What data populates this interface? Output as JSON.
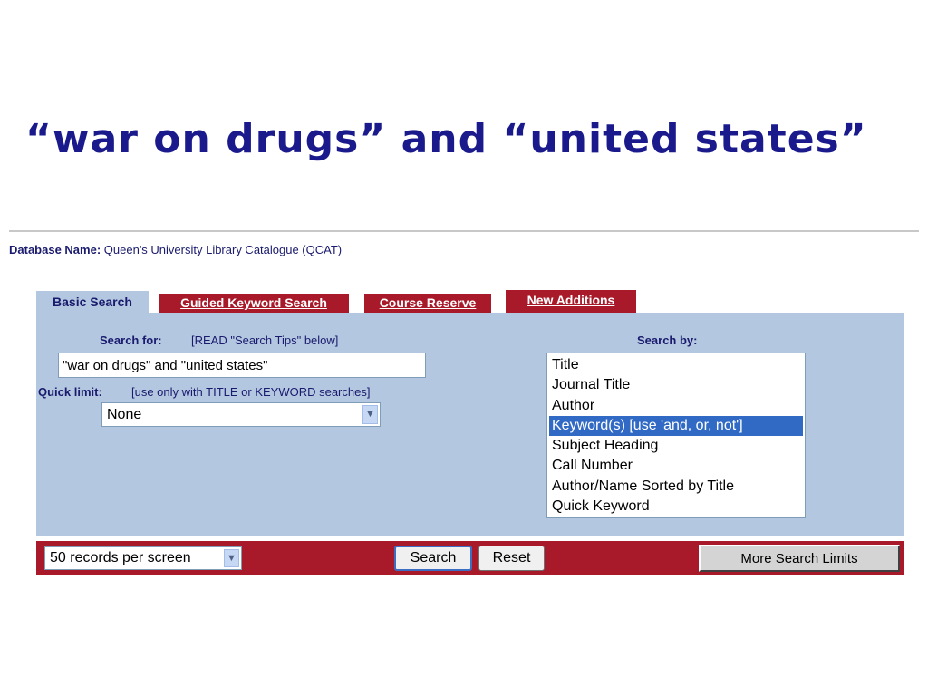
{
  "slide": {
    "title": "“war on drugs” and “united states”"
  },
  "database": {
    "label": "Database Name:",
    "value": "Queen's University Library Catalogue (QCAT)"
  },
  "tabs": [
    {
      "label": "Basic Search",
      "active": true
    },
    {
      "label": "Guided Keyword Search",
      "active": false
    },
    {
      "label": "Course Reserve",
      "active": false
    },
    {
      "label": "New Additions",
      "active": false
    }
  ],
  "search_for": {
    "label": "Search for:",
    "hint": "[READ \"Search Tips\" below]",
    "value": "\"war on drugs\" and \"united states\""
  },
  "quick_limit": {
    "label": "Quick limit:",
    "hint": "[use only with TITLE or KEYWORD searches]",
    "selected": "None"
  },
  "search_by": {
    "label": "Search by:",
    "options": [
      "Title",
      "Journal Title",
      "Author",
      "Keyword(s)   [use 'and, or, not']",
      "Subject Heading",
      "Call Number",
      "Author/Name Sorted by Title",
      "Quick Keyword"
    ],
    "selected_index": 3
  },
  "bottom_bar": {
    "records_per_screen": "50 records per screen",
    "search_label": "Search",
    "reset_label": "Reset",
    "more_limits_label": "More Search Limits"
  },
  "colors": {
    "title_blue": "#1a1a8c",
    "label_navy": "#1a1a6e",
    "panel_blue": "#b3c8e0",
    "tab_red": "#a81a2a",
    "selection_blue": "#316ac5"
  }
}
